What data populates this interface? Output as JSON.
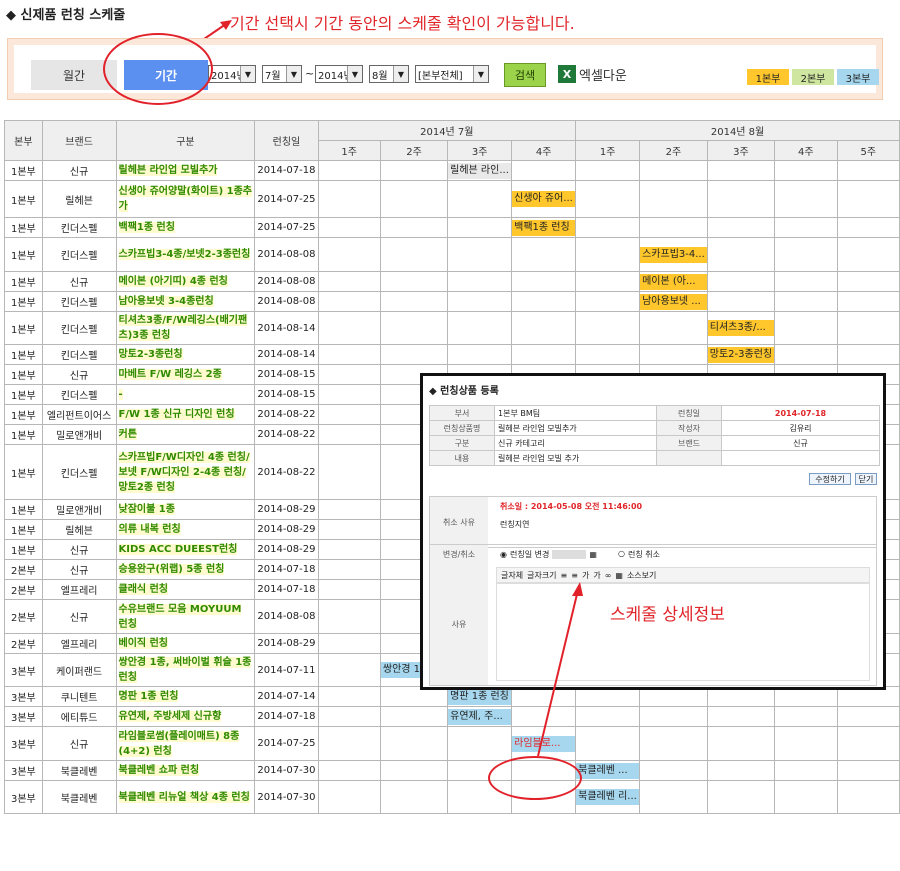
{
  "page": {
    "title": "◆ 신제품 런칭 스케줄",
    "note": "기간 선택시 기간 동안의 스케줄 확인이 가능합니다.",
    "detail_note": "스케줄 상세정보"
  },
  "toolbar": {
    "tab_monthly": "월간",
    "tab_period": "기간",
    "from_year": "2014년",
    "from_month": "7월",
    "tilde": "~",
    "to_year": "2014년",
    "to_month": "8월",
    "division": "[본부전체]",
    "search": "검색",
    "excel": "엑셀다운",
    "legend": [
      {
        "label": "1본부",
        "color": "#ffc72c"
      },
      {
        "label": "2본부",
        "color": "#cfe6a0"
      },
      {
        "label": "3본부",
        "color": "#a6d7ee"
      }
    ]
  },
  "table": {
    "headers": {
      "division": "본부",
      "brand": "브랜드",
      "category": "구분",
      "launch": "런칭일"
    },
    "months": [
      "2014년 7월",
      "2014년 8월"
    ],
    "weeks": [
      "1주",
      "2주",
      "3주",
      "4주",
      "1주",
      "2주",
      "3주",
      "4주",
      "5주"
    ],
    "rows": [
      {
        "div": "1본부",
        "brand": "신규",
        "prod": "릴헤븐 라인업 모빌추가",
        "date": "2014-07-18",
        "bar": "릴헤븐 라인...",
        "col": 2,
        "span": 1,
        "bc": "plain"
      },
      {
        "div": "1본부",
        "brand": "릴헤븐",
        "prod": "신생아 쥬어양말(화이트) 1종추가",
        "date": "2014-07-25",
        "bar": "신생아 쥬어...",
        "col": 3,
        "span": 1,
        "bc": "b1"
      },
      {
        "div": "1본부",
        "brand": "킨더스펠",
        "prod": "백팩1종 런칭",
        "date": "2014-07-25",
        "bar": "백팩1종 런칭",
        "col": 3,
        "span": 1,
        "bc": "b1"
      },
      {
        "div": "1본부",
        "brand": "킨더스펠",
        "prod": "스카프빕3-4종/보넷2-3종런칭",
        "date": "2014-08-08",
        "bar": "스카프빕3-4...",
        "col": 5,
        "span": 1,
        "bc": "b1"
      },
      {
        "div": "1본부",
        "brand": "신규",
        "prod": "메이본 (아기띠) 4종 런칭",
        "date": "2014-08-08",
        "bar": "메이본 (아...",
        "col": 5,
        "span": 1,
        "bc": "b1"
      },
      {
        "div": "1본부",
        "brand": "킨더스펠",
        "prod": "남아용보넷 3-4종런칭",
        "date": "2014-08-08",
        "bar": "남아용보넷 ...",
        "col": 5,
        "span": 1,
        "bc": "b1"
      },
      {
        "div": "1본부",
        "brand": "킨더스펠",
        "prod": "티셔츠3종/F/W레깅스(배기팬츠)3종 런칭",
        "date": "2014-08-14",
        "bar": "티셔츠3종/...",
        "col": 6,
        "span": 1,
        "bc": "b1"
      },
      {
        "div": "1본부",
        "brand": "킨더스펠",
        "prod": "망토2-3종런칭",
        "date": "2014-08-14",
        "bar": "망토2-3종런칭",
        "col": 6,
        "span": 1,
        "bc": "b1"
      },
      {
        "div": "1본부",
        "brand": "신규",
        "prod": "마베트 F/W 레깅스 2종",
        "date": "2014-08-15",
        "bar": "",
        "col": -1,
        "span": 0,
        "bc": ""
      },
      {
        "div": "1본부",
        "brand": "킨더스펠",
        "prod": "-",
        "date": "2014-08-15",
        "bar": "",
        "col": -1,
        "span": 0,
        "bc": ""
      },
      {
        "div": "1본부",
        "brand": "엘리펀트이어스",
        "prod": "F/W 1종 신규 디자인 런칭",
        "date": "2014-08-22",
        "bar": "",
        "col": -1,
        "span": 0,
        "bc": ""
      },
      {
        "div": "1본부",
        "brand": "밀로앤개비",
        "prod": "커튼",
        "date": "2014-08-22",
        "bar": "",
        "col": -1,
        "span": 0,
        "bc": ""
      },
      {
        "div": "1본부",
        "brand": "킨더스펠",
        "prod": "스카프빕F/W디자인 4종 런칭/보넷 F/W디자인 2-4종 런칭/망토2종 런칭",
        "date": "2014-08-22",
        "bar": "",
        "col": -1,
        "span": 0,
        "bc": ""
      },
      {
        "div": "1본부",
        "brand": "밀로앤개비",
        "prod": "낮잠이불 1종",
        "date": "2014-08-29",
        "bar": "",
        "col": -1,
        "span": 0,
        "bc": ""
      },
      {
        "div": "1본부",
        "brand": "릴헤븐",
        "prod": "의류 내복 런칭",
        "date": "2014-08-29",
        "bar": "",
        "col": -1,
        "span": 0,
        "bc": ""
      },
      {
        "div": "1본부",
        "brand": "신규",
        "prod": "KIDS ACC DUEEST런칭",
        "date": "2014-08-29",
        "bar": "",
        "col": -1,
        "span": 0,
        "bc": ""
      },
      {
        "div": "2본부",
        "brand": "신규",
        "prod": "승용완구(위랩) 5종 런칭",
        "date": "2014-07-18",
        "bar": "",
        "col": -1,
        "span": 0,
        "bc": ""
      },
      {
        "div": "2본부",
        "brand": "엘프레리",
        "prod": "클래식 런칭",
        "date": "2014-07-18",
        "bar": "",
        "col": -1,
        "span": 0,
        "bc": ""
      },
      {
        "div": "2본부",
        "brand": "신규",
        "prod": "수유브랜드 모음 MOYUUM 런칭",
        "date": "2014-08-08",
        "bar": "",
        "col": -1,
        "span": 0,
        "bc": ""
      },
      {
        "div": "2본부",
        "brand": "엘프레리",
        "prod": "베이직 런칭",
        "date": "2014-08-29",
        "bar": "",
        "col": -1,
        "span": 0,
        "bc": ""
      },
      {
        "div": "3본부",
        "brand": "케이퍼랜드",
        "prod": "쌍안경 1종, 써바이벌 휘슬 1종 런칭",
        "date": "2014-07-11",
        "bar": "쌍안경 1종, ...",
        "col": 1,
        "span": 1,
        "bc": "b3"
      },
      {
        "div": "3본부",
        "brand": "쿠니텐트",
        "prod": "명판 1종 런칭",
        "date": "2014-07-14",
        "bar": "명판 1종 런칭",
        "col": 2,
        "span": 1,
        "bc": "b3"
      },
      {
        "div": "3본부",
        "brand": "에티튜드",
        "prod": "유연제, 주방세제 신규향",
        "date": "2014-07-18",
        "bar": "유연제, 주...",
        "col": 2,
        "span": 1,
        "bc": "b3"
      },
      {
        "div": "3본부",
        "brand": "신규",
        "prod": "라임블로썸(플레이매트) 8종(4+2) 런칭",
        "date": "2014-07-25",
        "bar": "라임블로...",
        "col": 3,
        "span": 1,
        "bc": "b3"
      },
      {
        "div": "3본부",
        "brand": "북클레벤",
        "prod": "북클레벤 쇼파 런칭",
        "date": "2014-07-30",
        "bar": "북클레벤 ...",
        "col": 4,
        "span": 1,
        "bc": "b3"
      },
      {
        "div": "3본부",
        "brand": "북클레벤",
        "prod": "북클레벤 리뉴얼 책상 4종 런칭",
        "date": "2014-07-30",
        "bar": "북클레벤 리...",
        "col": 4,
        "span": 1,
        "bc": "b3"
      }
    ]
  },
  "modal": {
    "title": "◆ 런칭상품 등록",
    "fields": [
      [
        "부서",
        "1본부 BM팀",
        "런칭일",
        "2014-07-18"
      ],
      [
        "런칭상품명",
        "릴헤븐 라인업 모빌추가",
        "작성자",
        "김유리"
      ],
      [
        "구분",
        "신규 카테고리",
        "브랜드",
        "신규"
      ],
      [
        "내용",
        "릴헤븐 라인업 모빌 추가",
        "",
        ""
      ]
    ],
    "edit_btn": "수정하기",
    "close_btn": "닫기",
    "cancel_label": "취소 사유",
    "cancel_date": "취소일 : 2014-05-08 오전 11:46:00",
    "cancel_reason": "런칭지연",
    "change_label": "변경/취소",
    "radio_change": "런칭일 변경",
    "radio_cancel": "런칭 취소",
    "reason_label": "사유",
    "editor_font": "글자체",
    "editor_size": "글자크기",
    "editor_source": "소스보기"
  }
}
